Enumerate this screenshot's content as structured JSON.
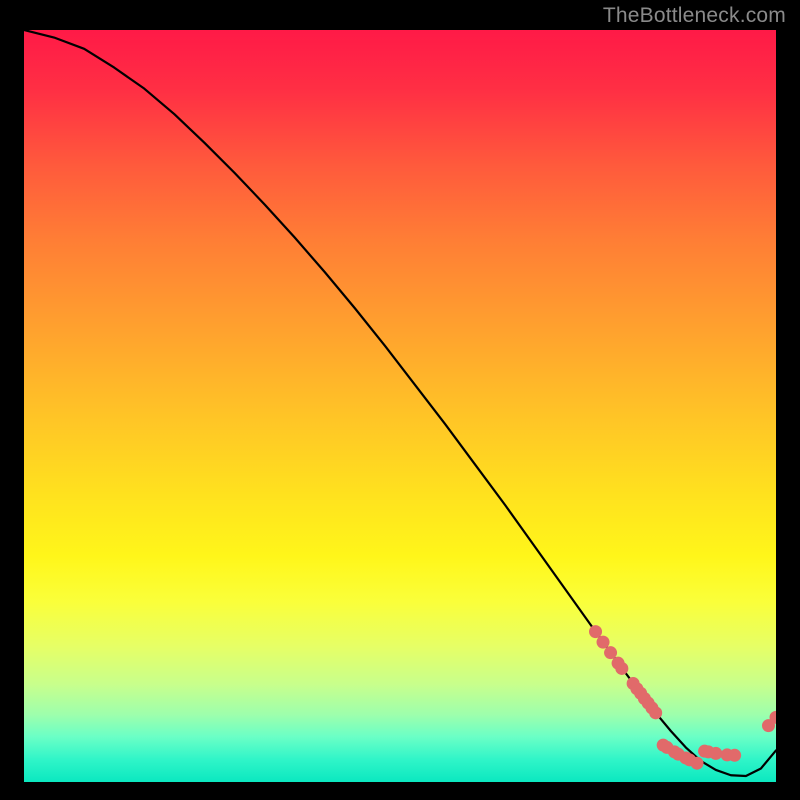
{
  "watermark": "TheBottleneck.com",
  "chart_data": {
    "type": "line",
    "title": "",
    "xlabel": "",
    "ylabel": "",
    "xlim": [
      0,
      100
    ],
    "ylim": [
      0,
      100
    ],
    "grid": false,
    "series": [
      {
        "name": "curve",
        "x": [
          0,
          4,
          8,
          12,
          16,
          20,
          24,
          28,
          32,
          36,
          40,
          44,
          48,
          52,
          56,
          60,
          64,
          68,
          72,
          76,
          80,
          82,
          84,
          86,
          88,
          90,
          92,
          94,
          96,
          98,
          100
        ],
        "values": [
          100,
          99,
          97.5,
          95,
          92.2,
          88.8,
          85,
          81,
          76.8,
          72.4,
          67.8,
          63,
          58,
          52.8,
          47.6,
          42.2,
          36.8,
          31.2,
          25.6,
          20,
          14.5,
          11.8,
          9.2,
          6.8,
          4.6,
          2.8,
          1.6,
          0.9,
          0.8,
          1.8,
          4.2
        ]
      }
    ],
    "markers": [
      {
        "x": 76,
        "y": 20.0
      },
      {
        "x": 77,
        "y": 18.6
      },
      {
        "x": 78,
        "y": 17.2
      },
      {
        "x": 79,
        "y": 15.8
      },
      {
        "x": 79.5,
        "y": 15.1
      },
      {
        "x": 81,
        "y": 13.1
      },
      {
        "x": 81.5,
        "y": 12.4
      },
      {
        "x": 82,
        "y": 11.8
      },
      {
        "x": 82.5,
        "y": 11.1
      },
      {
        "x": 83,
        "y": 10.5
      },
      {
        "x": 83.5,
        "y": 9.85
      },
      {
        "x": 84,
        "y": 9.2
      },
      {
        "x": 85,
        "y": 4.9
      },
      {
        "x": 85.5,
        "y": 4.6
      },
      {
        "x": 86.5,
        "y": 4.0
      },
      {
        "x": 87,
        "y": 3.7
      },
      {
        "x": 88,
        "y": 3.2
      },
      {
        "x": 88.5,
        "y": 2.95
      },
      {
        "x": 89.5,
        "y": 2.5
      },
      {
        "x": 90.5,
        "y": 4.1
      },
      {
        "x": 91,
        "y": 4.0
      },
      {
        "x": 92,
        "y": 3.8
      },
      {
        "x": 93.5,
        "y": 3.6
      },
      {
        "x": 94.5,
        "y": 3.55
      },
      {
        "x": 99,
        "y": 7.5
      },
      {
        "x": 100,
        "y": 8.6
      }
    ],
    "colors": {
      "line": "#000000",
      "marker": "#e16a6a",
      "gradient_top": "#ff1a47",
      "gradient_bottom": "#0be8c0"
    }
  }
}
